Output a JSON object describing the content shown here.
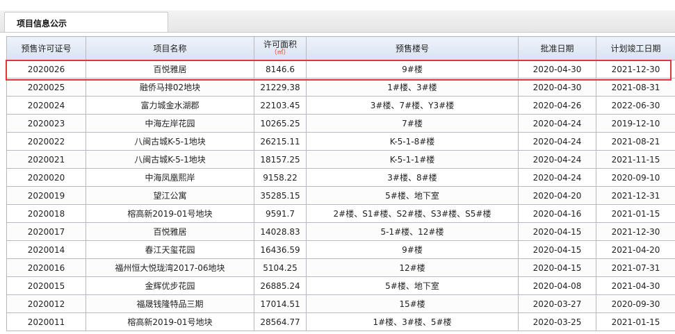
{
  "tab": {
    "label": "项目信息公示"
  },
  "table": {
    "headers": {
      "permit_no": "预售许可证号",
      "project_name": "项目名称",
      "area": "许可面积",
      "area_unit": "（㎡）",
      "buildings": "预售楼号",
      "approval_date": "批准日期",
      "completion_date": "计划竣工日期"
    },
    "rows": [
      {
        "permit_no": "2020026",
        "project_name": "百悦雅居",
        "area": "8146.6",
        "buildings": "9#楼",
        "approval_date": "2020-04-30",
        "completion_date": "2021-12-30"
      },
      {
        "permit_no": "2020025",
        "project_name": "融侨马排02地块",
        "area": "21229.38",
        "buildings": "1#楼、3#楼",
        "approval_date": "2020-04-30",
        "completion_date": "2021-08-31"
      },
      {
        "permit_no": "2020024",
        "project_name": "富力城金水湖郡",
        "area": "22103.45",
        "buildings": "3#楼、7#楼、Y3#楼",
        "approval_date": "2020-04-26",
        "completion_date": "2022-06-30"
      },
      {
        "permit_no": "2020023",
        "project_name": "中海左岸花园",
        "area": "10265.25",
        "buildings": "7#楼",
        "approval_date": "2020-04-24",
        "completion_date": "2019-12-10"
      },
      {
        "permit_no": "2020022",
        "project_name": "八闽古城K-5-1地块",
        "area": "26215.11",
        "buildings": "K-5-1-8#楼",
        "approval_date": "2020-04-24",
        "completion_date": "2021-08-21"
      },
      {
        "permit_no": "2020021",
        "project_name": "八闽古城K-5-1地块",
        "area": "18157.25",
        "buildings": "K-5-1-1#楼",
        "approval_date": "2020-04-24",
        "completion_date": "2021-11-15"
      },
      {
        "permit_no": "2020020",
        "project_name": "中海凤凰熙岸",
        "area": "9158.22",
        "buildings": "3#楼、8#楼",
        "approval_date": "2020-04-24",
        "completion_date": "2020-09-10"
      },
      {
        "permit_no": "2020019",
        "project_name": "望江公寓",
        "area": "35285.15",
        "buildings": "5#楼、地下室",
        "approval_date": "2020-04-20",
        "completion_date": "2021-12-31"
      },
      {
        "permit_no": "2020018",
        "project_name": "榕高新2019-01号地块",
        "area": "9591.7",
        "buildings": "2#楼、S1#楼、S2#楼、S3#楼、S5#楼",
        "approval_date": "2020-04-16",
        "completion_date": "2021-01-15"
      },
      {
        "permit_no": "2020017",
        "project_name": "百悦雅居",
        "area": "14028.83",
        "buildings": "5-1#楼、12#楼",
        "approval_date": "2020-04-15",
        "completion_date": "2021-12-30"
      },
      {
        "permit_no": "2020014",
        "project_name": "春江天玺花园",
        "area": "16436.59",
        "buildings": "9#楼",
        "approval_date": "2020-04-15",
        "completion_date": "2021-04-20"
      },
      {
        "permit_no": "2020016",
        "project_name": "福州恒大悦珑湾2017-06地块",
        "area": "5104.25",
        "buildings": "12#楼",
        "approval_date": "2020-04-15",
        "completion_date": "2021-07-31"
      },
      {
        "permit_no": "2020015",
        "project_name": "金辉优步花园",
        "area": "26885.24",
        "buildings": "5#楼、地下室",
        "approval_date": "2020-04-08",
        "completion_date": "2021-04-30"
      },
      {
        "permit_no": "2020012",
        "project_name": "福晟钱隆特品三期",
        "area": "17014.51",
        "buildings": "15#楼",
        "approval_date": "2020-03-27",
        "completion_date": "2020-09-30"
      },
      {
        "permit_no": "2020011",
        "project_name": "榕高新2019-01号地块",
        "area": "28564.77",
        "buildings": "1#楼、3#楼、5#楼",
        "approval_date": "2020-03-25",
        "completion_date": "2021-01-15"
      }
    ]
  },
  "colors": {
    "highlight": "#e0353a",
    "header_bg": "#d8e3f1",
    "grid": "#b5b9c0"
  }
}
